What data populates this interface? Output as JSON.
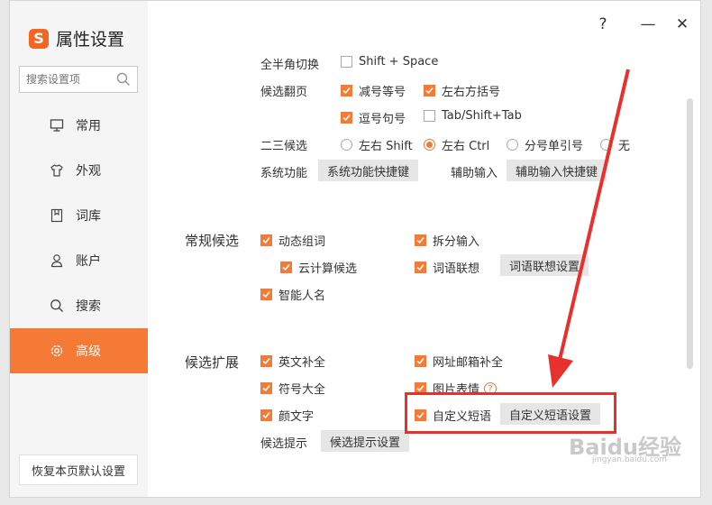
{
  "window": {
    "title": "属性设置",
    "help_label": "?",
    "minimize_label": "—",
    "close_label": "✕"
  },
  "search": {
    "placeholder": "搜索设置项"
  },
  "sidebar": {
    "items": [
      {
        "label": "常用",
        "icon": "monitor-icon"
      },
      {
        "label": "外观",
        "icon": "shirt-icon"
      },
      {
        "label": "词库",
        "icon": "book-icon"
      },
      {
        "label": "账户",
        "icon": "user-icon"
      },
      {
        "label": "搜索",
        "icon": "search-icon"
      },
      {
        "label": "高级",
        "icon": "gear-icon",
        "active": true
      }
    ],
    "reset_label": "恢复本页默认设置"
  },
  "settings": {
    "fullhalf": {
      "label": "全半角切换",
      "option": "Shift + Space",
      "checked": false
    },
    "candidate_page": {
      "label": "候选翻页",
      "options": [
        {
          "text": "减号等号",
          "checked": true
        },
        {
          "text": "左右方括号",
          "checked": true
        },
        {
          "text": "逗号句号",
          "checked": true
        },
        {
          "text": "Tab/Shift+Tab",
          "checked": false
        }
      ]
    },
    "second_third": {
      "label": "二三候选",
      "options": [
        {
          "text": "左右 Shift",
          "selected": false
        },
        {
          "text": "左右 Ctrl",
          "selected": true
        },
        {
          "text": "分号单引号",
          "selected": false
        },
        {
          "text": "无",
          "selected": false
        }
      ]
    },
    "system_function": {
      "label": "系统功能",
      "button": "系统功能快捷键"
    },
    "assist_input": {
      "label": "辅助输入",
      "button": "辅助输入快捷键"
    },
    "general_candidates": {
      "label": "常规候选",
      "options": [
        {
          "text": "动态组词",
          "checked": true
        },
        {
          "text": "拆分输入",
          "checked": true
        },
        {
          "text": "云计算候选",
          "checked": true
        },
        {
          "text": "词语联想",
          "checked": true
        },
        {
          "text": "智能人名",
          "checked": true
        }
      ],
      "association_button": "词语联想设置"
    },
    "candidate_extension": {
      "label": "候选扩展",
      "options": [
        {
          "text": "英文补全",
          "checked": true
        },
        {
          "text": "网址邮箱补全",
          "checked": true
        },
        {
          "text": "符号大全",
          "checked": true
        },
        {
          "text": "图片表情",
          "checked": true
        },
        {
          "text": "颜文字",
          "checked": true
        },
        {
          "text": "自定义短语",
          "checked": true
        }
      ],
      "custom_phrase_button": "自定义短语设置",
      "help_label": "?"
    },
    "candidate_hint": {
      "label": "候选提示",
      "button": "候选提示设置"
    }
  },
  "annotation": {
    "highlight_color": "#e8312c"
  },
  "watermark": {
    "text": "Baidu经验",
    "url_text": "jingyan.baidu.com"
  },
  "colors": {
    "accent": "#f47a36",
    "brand": "#f26522"
  }
}
